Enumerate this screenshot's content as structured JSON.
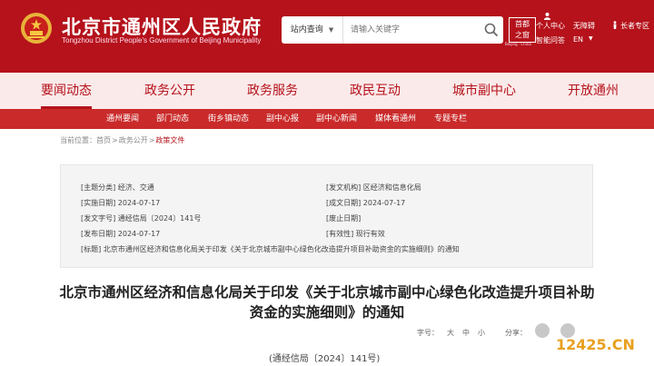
{
  "header": {
    "site_name": "北京市通州区人民政府",
    "site_name_en": "Tongzhou District People's Government of Beijing Municipality",
    "search": {
      "scope": "站内查询",
      "placeholder": "请输入关键字"
    },
    "gov_logo": {
      "line1": "首都",
      "line2": "之窗",
      "subtitle": "Beijing · China"
    },
    "links": {
      "personal_center": "个人中心",
      "accessibility": "无障碍",
      "elder_mode": "长者专区",
      "smart_qa": "智能问答",
      "language": "EN"
    }
  },
  "main_nav": [
    "要闻动态",
    "政务公开",
    "政务服务",
    "政民互动",
    "城市副中心",
    "开放通州"
  ],
  "sub_nav": [
    "通州要闻",
    "部门动态",
    "街乡镇动态",
    "副中心报",
    "副中心新闻",
    "媒体看通州",
    "专题专栏"
  ],
  "breadcrumb": {
    "label": "当前位置：",
    "items": [
      "首页",
      "政务公开",
      "政策文件"
    ],
    "separator": ">"
  },
  "info": {
    "topic": "[主题分类] 经济、交通",
    "issuer": "[发文机构] 区经济和信息化局",
    "effective_date": "[实施日期] 2024-07-17",
    "formed_date": "[成文日期] 2024-07-17",
    "doc_no": "[发文字号] 通经信局〔2024〕141号",
    "abolish_date": "[废止日期]",
    "publish_date": "[发布日期] 2024-07-17",
    "validity": "[有效性] 现行有效",
    "title": "[标题] 北京市通州区经济和信息化局关于印发《关于北京城市副中心绿色化改造提升项目补助资金的实施细则》的通知"
  },
  "doc": {
    "title": "北京市通州区经济和信息化局关于印发《关于北京城市副中心绿色化改造提升项目补助资金的实施细则》的通知",
    "font_size_label": "字号：",
    "font_sizes": [
      "大",
      "中",
      "小"
    ],
    "share_label": "分享：",
    "number": "(通经信局〔2024〕141号)"
  },
  "watermark": "12425.CN",
  "colors": {
    "brand_red": "#b5121b",
    "subnav_red": "#ca2a2a",
    "nav_bg": "#fbeaea"
  }
}
